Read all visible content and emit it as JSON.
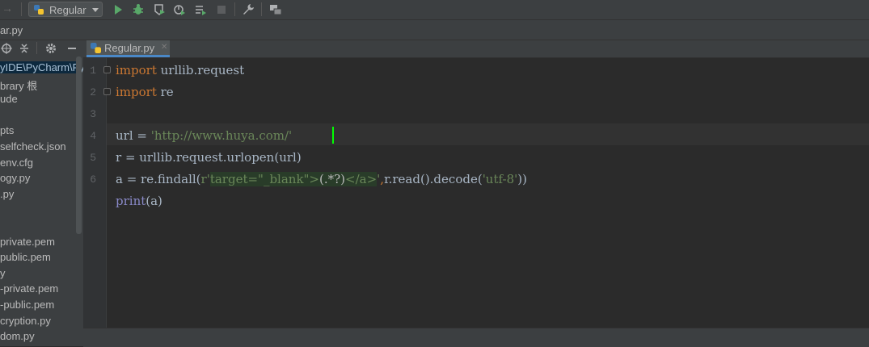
{
  "toolbar": {
    "run_config_label": "Regular",
    "icons": [
      "back-arrow-icon",
      "python-file-icon",
      "run-icon",
      "debug-icon",
      "coverage-icon",
      "profile-icon",
      "concurrency-icon",
      "stop-icon",
      "settings-wrench-icon",
      "project-structure-icon"
    ]
  },
  "breadcrumb": {
    "file": "ar.py"
  },
  "project_panel": {
    "items": [
      {
        "label": "yIDE\\PyCharm\\Py",
        "selected": true
      },
      {
        "label": "brary 根",
        "selected": false
      },
      {
        "label": "ude",
        "selected": false
      },
      {
        "label": "",
        "selected": false
      },
      {
        "label": "pts",
        "selected": false
      },
      {
        "label": "selfcheck.json",
        "selected": false
      },
      {
        "label": "env.cfg",
        "selected": false
      },
      {
        "label": "ogy.py",
        "selected": false
      },
      {
        "label": ".py",
        "selected": false
      },
      {
        "label": "",
        "selected": false
      },
      {
        "label": "",
        "selected": false
      },
      {
        "label": "private.pem",
        "selected": false
      },
      {
        "label": "public.pem",
        "selected": false
      },
      {
        "label": "y",
        "selected": false
      },
      {
        "label": "-private.pem",
        "selected": false
      },
      {
        "label": "-public.pem",
        "selected": false
      },
      {
        "label": "cryption.py",
        "selected": false
      },
      {
        "label": "dom.py",
        "selected": false
      }
    ]
  },
  "editor": {
    "tab_label": "Regular.py",
    "line_numbers": [
      "1",
      "2",
      "3",
      "4",
      "5",
      "6"
    ],
    "lines": {
      "l1_kw": "import",
      "l1_rest": " urllib.request",
      "l2_kw": "import",
      "l2_rest": " re",
      "l4_a": "url = ",
      "l4_str": "'http://www.huya.com/'",
      "l5": "r = urllib.request.urlopen(url)",
      "l6_a": "a = re.findall(",
      "l6_prefix": "r'",
      "l6_regex1": "target=\"_blank\">",
      "l6_group": "(.*?)",
      "l6_regex2": "</a>",
      "l6_end_quote": "'",
      "l6_comma": ",",
      "l6_b": "r.read().decode(",
      "l6_str": "'utf-8'",
      "l6_c": "))",
      "l7_kw": "print",
      "l7_rest": "(a)"
    }
  },
  "colors": {
    "keyword": "#cc7832",
    "string": "#6a8759",
    "text": "#a9b7c6",
    "caret": "#00ff00"
  }
}
